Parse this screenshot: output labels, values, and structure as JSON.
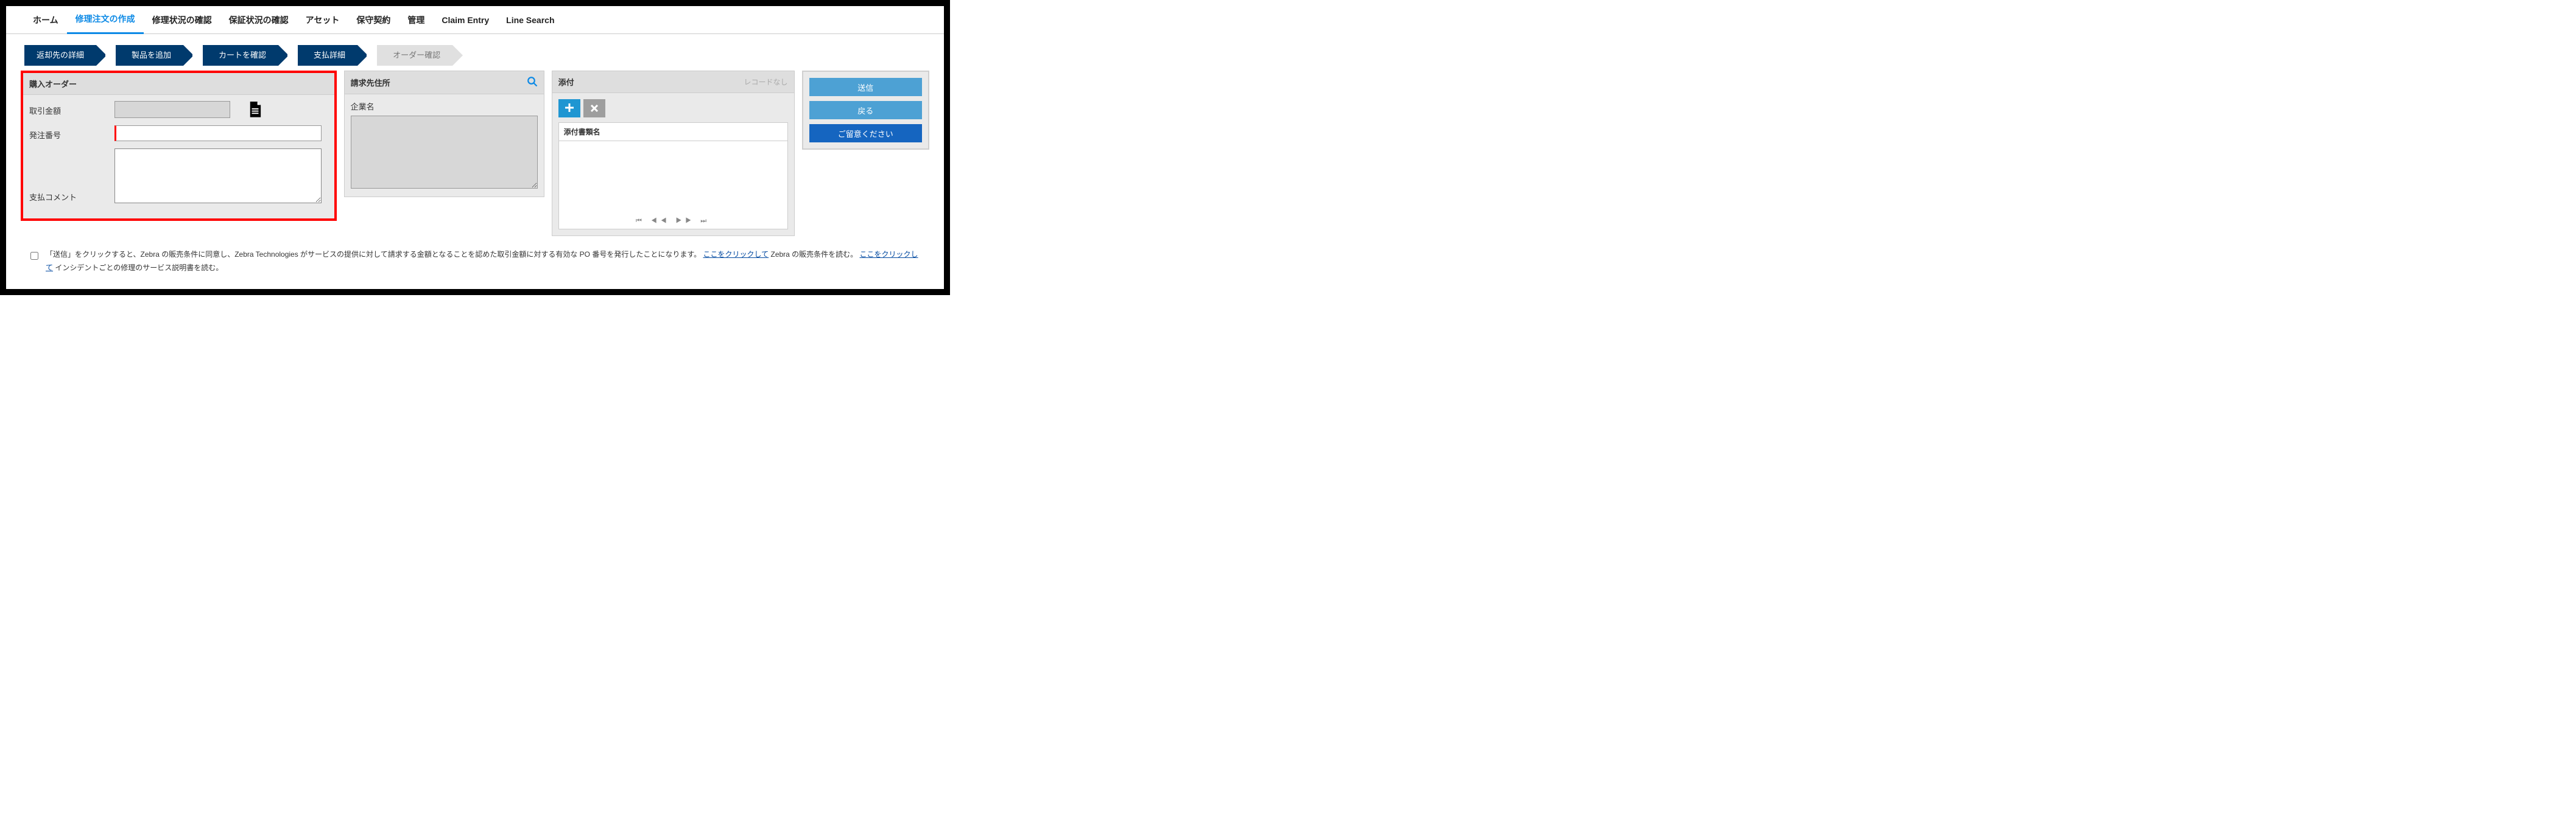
{
  "nav": {
    "items": [
      {
        "label": "ホーム"
      },
      {
        "label": "修理注文の作成",
        "active": true
      },
      {
        "label": "修理状況の確認"
      },
      {
        "label": "保証状況の確認"
      },
      {
        "label": "アセット"
      },
      {
        "label": "保守契約"
      },
      {
        "label": "管理"
      },
      {
        "label": "Claim Entry"
      },
      {
        "label": "Line Search"
      }
    ]
  },
  "steps": [
    {
      "label": "返却先の詳細"
    },
    {
      "label": "製品を追加"
    },
    {
      "label": "カートを確認"
    },
    {
      "label": "支払詳細"
    },
    {
      "label": "オーダー確認",
      "light": true
    }
  ],
  "po": {
    "title": "購入オーダー",
    "fields": {
      "amount_label": "取引金額",
      "po_number_label": "発注番号",
      "comment_label": "支払コメント"
    }
  },
  "billing": {
    "title": "請求先住所",
    "company_label": "企業名"
  },
  "attach": {
    "title": "添付",
    "no_records": "レコードなし",
    "doc_name": "添付書類名"
  },
  "actions": {
    "submit": "送信",
    "back": "戻る",
    "notice": "ご留意ください"
  },
  "footer": {
    "t1": "「送信」をクリックすると、Zebra の販売条件に同意し、Zebra Technologies がサービスの提供に対して請求する金額となることを認めた取引金額に対する有効な PO 番号を発行したことになります。",
    "link1": "ここをクリックして",
    "t2": " Zebra の販売条件を読む。 ",
    "link2": "ここをクリックして",
    "t3": " インシデントごとの修理のサービス説明書を読む。"
  }
}
